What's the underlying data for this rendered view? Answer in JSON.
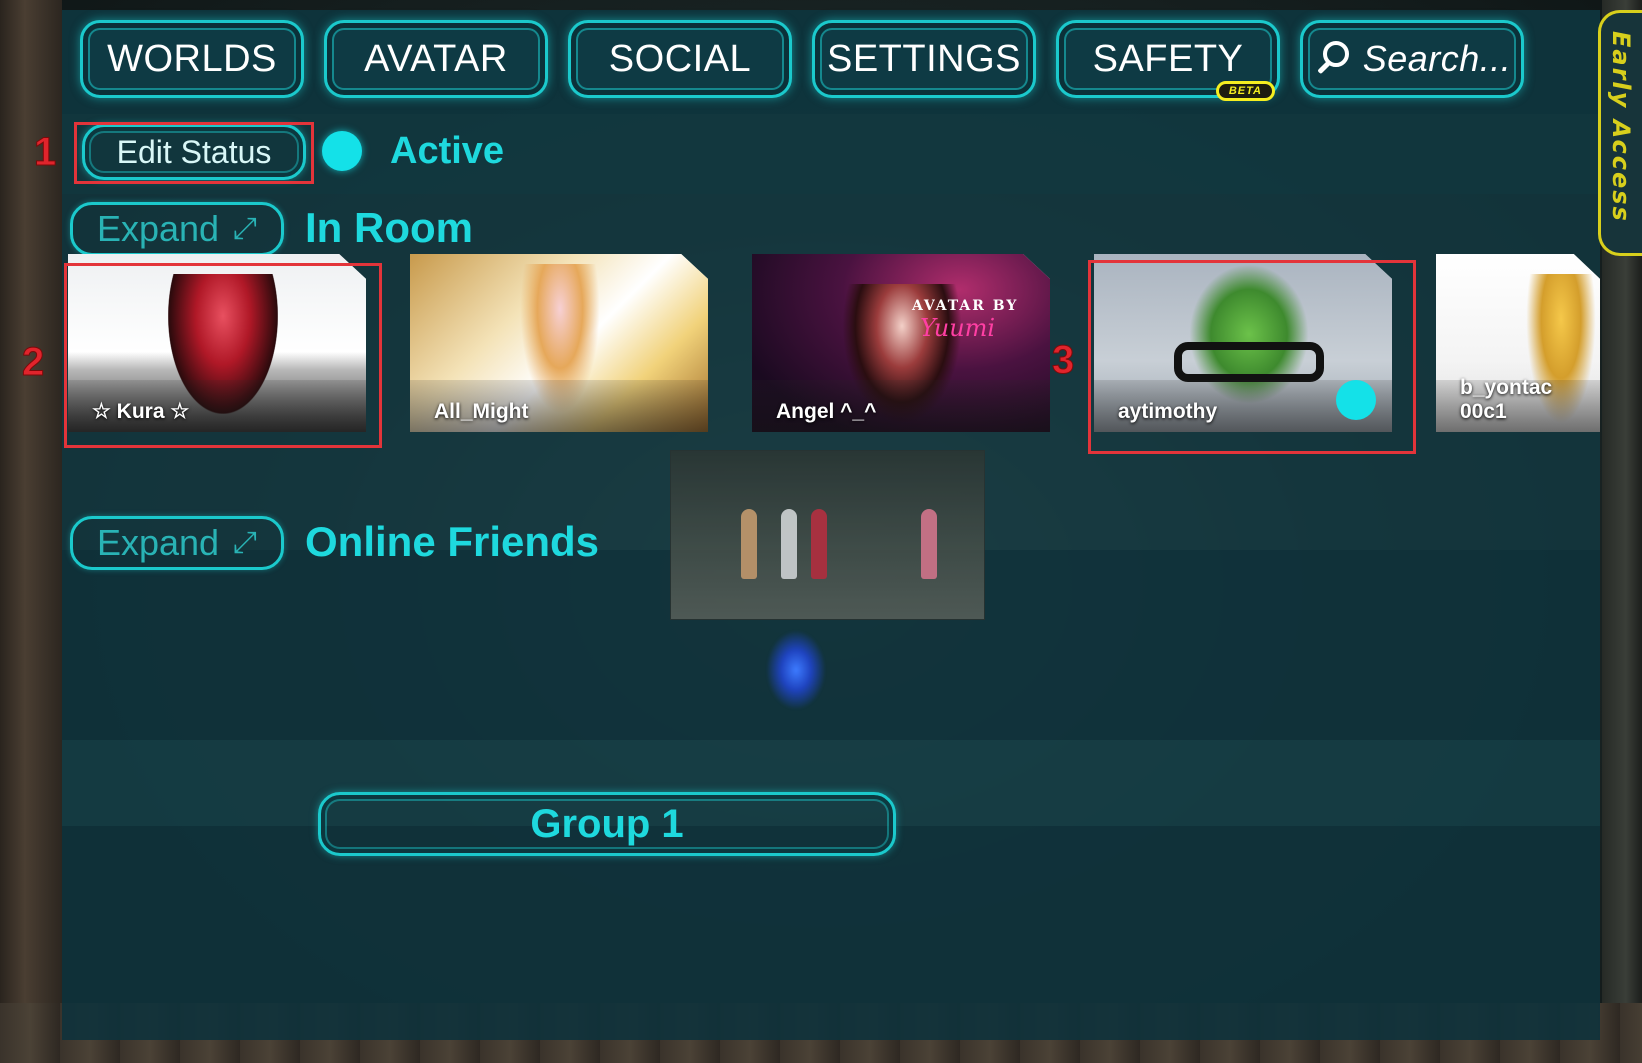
{
  "nav": {
    "worlds": "WORLDS",
    "avatar": "AVATAR",
    "social": "SOCIAL",
    "settings": "SETTINGS",
    "safety": "SAFETY",
    "safety_badge": "BETA",
    "search_placeholder": "Search...",
    "search_icon": "search-icon"
  },
  "early_access": "Early Access",
  "status": {
    "edit_label": "Edit Status",
    "value": "Active",
    "color": "#14e1e8"
  },
  "sections": {
    "in_room": {
      "expand_label": "Expand",
      "expand_icon": "⤢",
      "title": "In Room"
    },
    "online_friends": {
      "expand_label": "Expand",
      "expand_icon": "⤢",
      "title": "Online Friends"
    },
    "group": {
      "label": "Group 1"
    }
  },
  "in_room_users": [
    {
      "name": "☆ Kura ☆",
      "online": false
    },
    {
      "name": "All_Might",
      "online": false
    },
    {
      "name": "Angel ^_^",
      "online": false
    },
    {
      "name": "aytimothy",
      "online": true
    },
    {
      "name": "b_yontac 00c1",
      "online": false
    }
  ],
  "card_text": {
    "angel_tag1": "AVATAR BY",
    "angel_tag2": "Yuumi"
  },
  "annotations": {
    "n1": "1",
    "n2": "2",
    "n3": "3"
  },
  "colors": {
    "accent": "#1bc9cc",
    "annotation": "#e3343a",
    "early_access": "#d8cf1c"
  }
}
